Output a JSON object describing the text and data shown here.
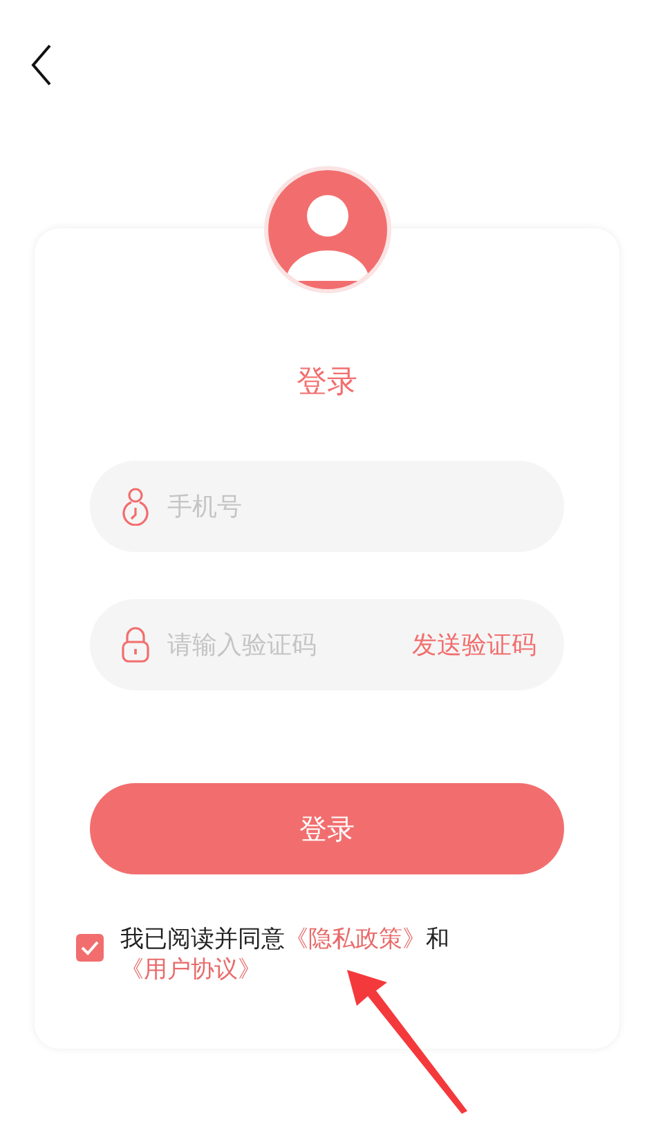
{
  "title": "登录",
  "fields": [
    {
      "kind": "phone",
      "placeholder": "手机号"
    },
    {
      "kind": "code",
      "placeholder": "请输入验证码",
      "action": "发送验证码"
    }
  ],
  "submit": "登录",
  "agreement": {
    "checked": true,
    "parts": [
      {
        "kind": "text",
        "text": "我已阅读并同意"
      },
      {
        "kind": "link",
        "text": "《隐私政策》"
      },
      {
        "kind": "text",
        "text": "和"
      },
      {
        "kind": "link",
        "text": "《用户协议》"
      }
    ]
  }
}
